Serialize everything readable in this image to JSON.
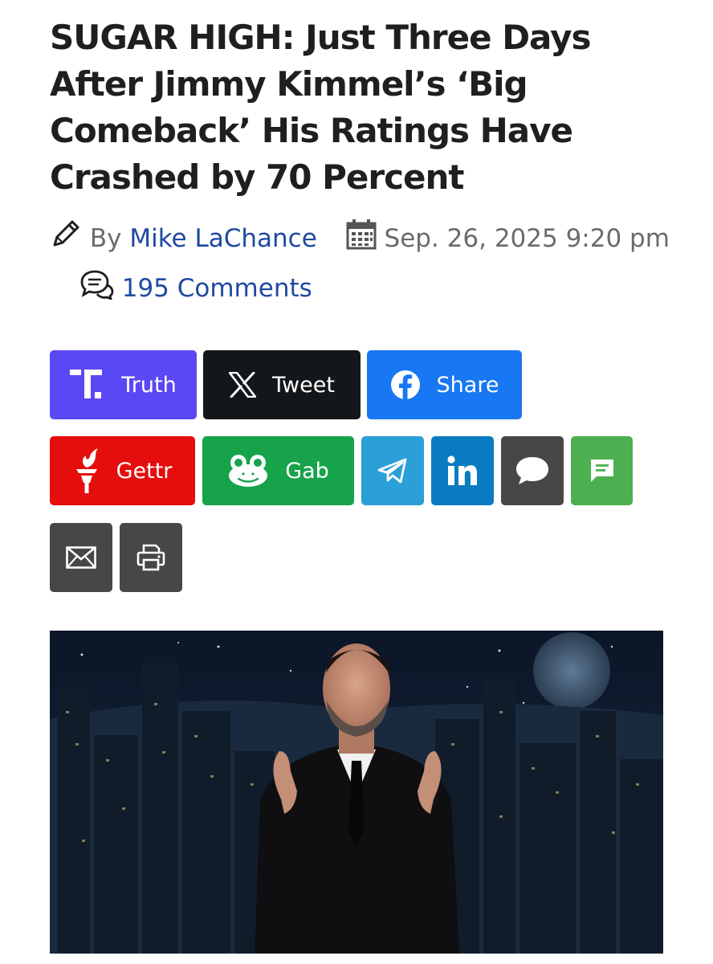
{
  "article": {
    "title": "SUGAR HIGH: Just Three Days After Jimmy Kimmel’s ‘Big Comeback’ His Ratings Have Crashed by 70 Percent",
    "by_label": "By",
    "author": "Mike LaChance",
    "date": "Sep. 26, 2025 9:20 pm",
    "comments": "195 Comments"
  },
  "share_buttons": [
    {
      "label": "Truth",
      "icon": "truth-social-icon",
      "color": "#5a48f4"
    },
    {
      "label": "Tweet",
      "icon": "x-icon",
      "color": "#14171a"
    },
    {
      "label": "Share",
      "icon": "facebook-icon",
      "color": "#1877f2"
    },
    {
      "label": "Gettr",
      "icon": "gettr-torch-icon",
      "color": "#e60d0d"
    },
    {
      "label": "Gab",
      "icon": "gab-frog-icon",
      "color": "#16a34a"
    },
    {
      "label": "",
      "icon": "telegram-icon",
      "color": "#2a9fd8"
    },
    {
      "label": "",
      "icon": "linkedin-icon",
      "color": "#0a7bc1"
    },
    {
      "label": "",
      "icon": "comment-bubble-icon",
      "color": "#474747"
    },
    {
      "label": "",
      "icon": "sms-icon",
      "color": "#4caf50"
    },
    {
      "label": "",
      "icon": "email-icon",
      "color": "#474747"
    },
    {
      "label": "",
      "icon": "print-icon",
      "color": "#474747"
    }
  ]
}
